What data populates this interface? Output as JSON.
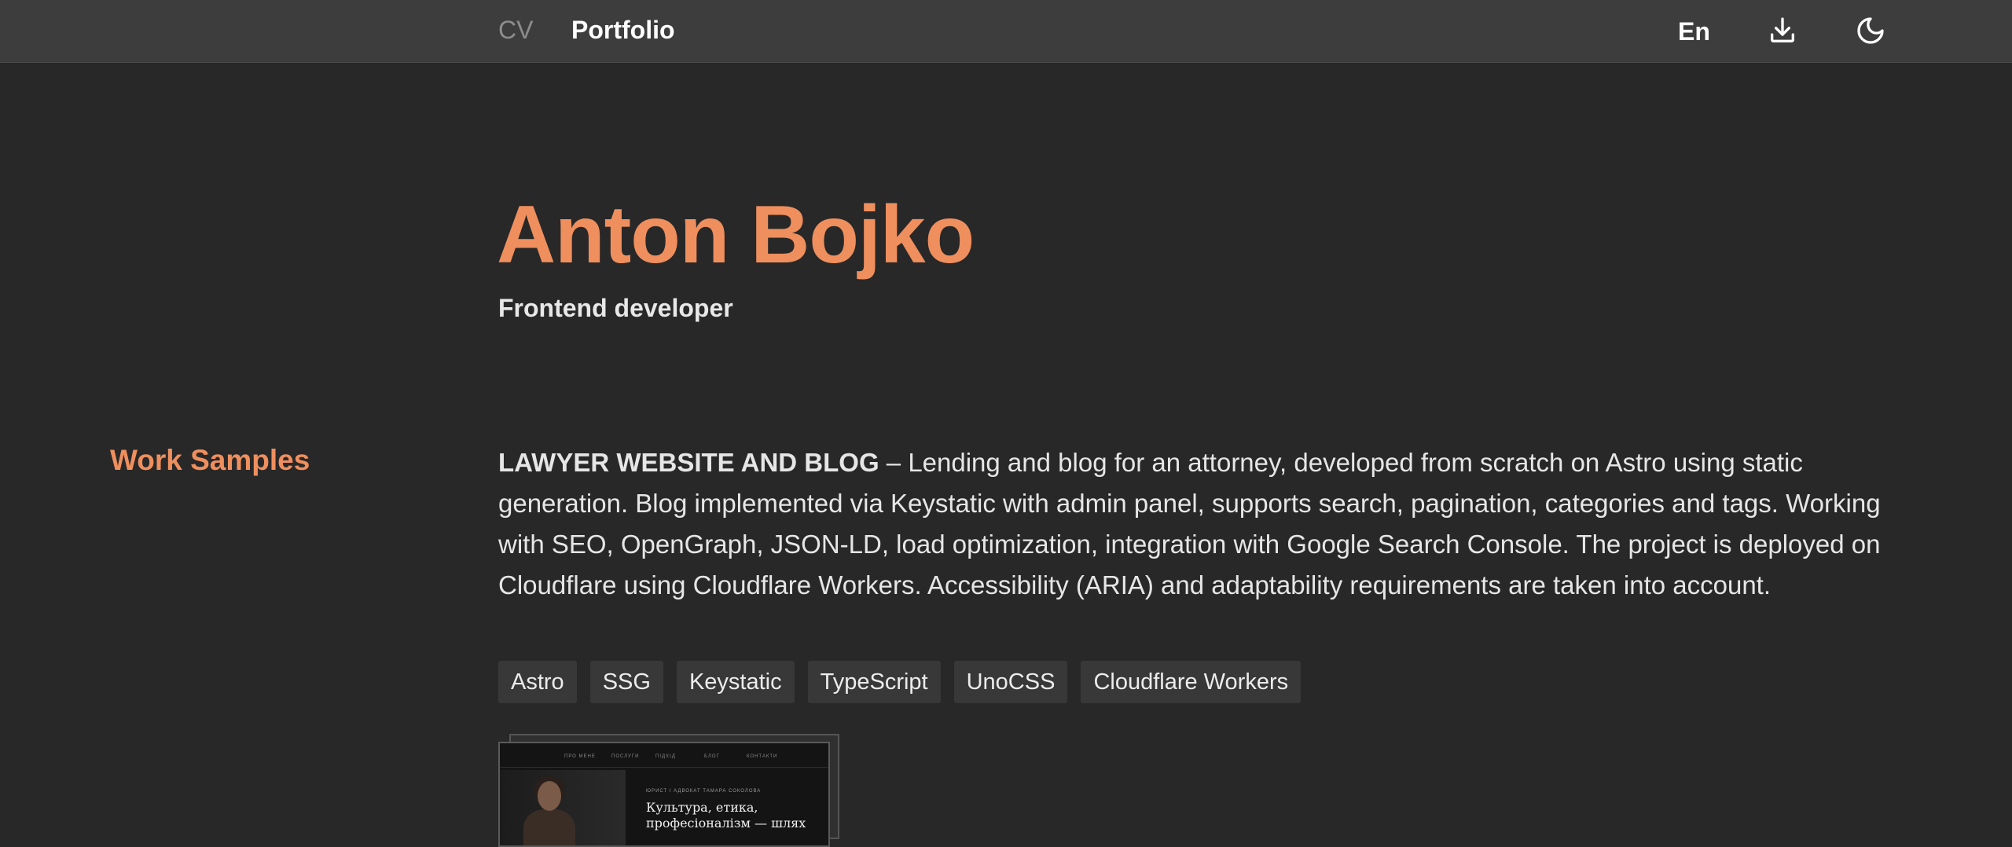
{
  "nav": {
    "cv_label": "CV",
    "portfolio_label": "Portfolio",
    "language": "En",
    "download_icon": "download-icon",
    "theme_icon": "moon-icon"
  },
  "hero": {
    "name": "Anton Bojko",
    "role": "Frontend developer"
  },
  "work_samples": {
    "section_title": "Work Samples",
    "items": [
      {
        "title": "LAWYER WEBSITE AND BLOG",
        "separator": " – ",
        "description": "Lending and blog for an attorney, developed from scratch on Astro using static generation. Blog implemented via Keystatic with admin panel, supports search, pagination, categories and tags. Working with SEO, OpenGraph, JSON-LD, load optimization, integration with Google Search Console. The project is deployed on Cloudflare using Cloudflare Workers. Accessibility (ARIA) and adaptability requirements are taken into account.",
        "tags": [
          "Astro",
          "SSG",
          "Keystatic",
          "TypeScript",
          "UnoCSS",
          "Cloudflare Workers"
        ],
        "screenshot": {
          "nav_items": [
            "ПРО МЕНЕ",
            "ПОСЛУГИ",
            "ПІДХІД",
            "БЛОГ",
            "КОНТАКТИ"
          ],
          "kicker": "ЮРИСТ І АДВОКАТ ТАМАРА СОКОЛОВА",
          "headline": "Культура, етика, професіоналізм — шлях"
        }
      }
    ]
  },
  "colors": {
    "accent": "#ef8f5e",
    "background": "#282828",
    "topbar": "#3d3d3d",
    "tag_bg": "#383838"
  }
}
